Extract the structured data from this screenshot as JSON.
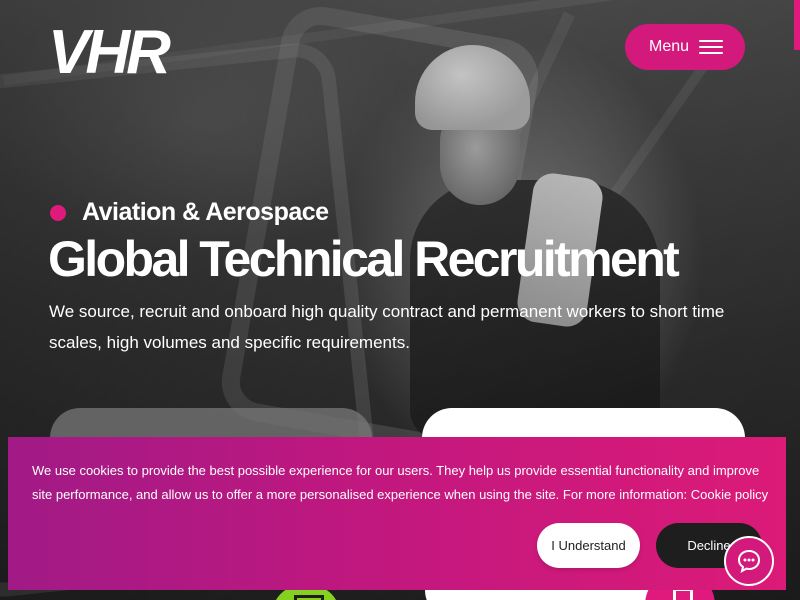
{
  "header": {
    "logo_text": "VHR",
    "menu_label": "Menu"
  },
  "hero": {
    "sector": "Aviation & Aerospace",
    "headline": "Global Technical Recruitment",
    "intro": "We source, recruit and onboard high quality contract and permanent workers to short time scales, high volumes and specific requirements."
  },
  "cookie_banner": {
    "message": "We use cookies to provide the best possible experience for our users. They help us provide essential functionality and improve site performance, and allow us to offer a more personalised experience when using the site. For more information:",
    "policy_link": "Cookie policy",
    "accept_label": "I Understand",
    "decline_label": "Decline"
  },
  "icons": {
    "menu": "hamburger-icon",
    "chat": "chat-bubble-icon"
  },
  "colors": {
    "brand_pink": "#e0197d",
    "banner_start": "#a11a86",
    "banner_end": "#dc1a78",
    "accent_green": "#86d11f",
    "dark": "#1e1e1e"
  }
}
